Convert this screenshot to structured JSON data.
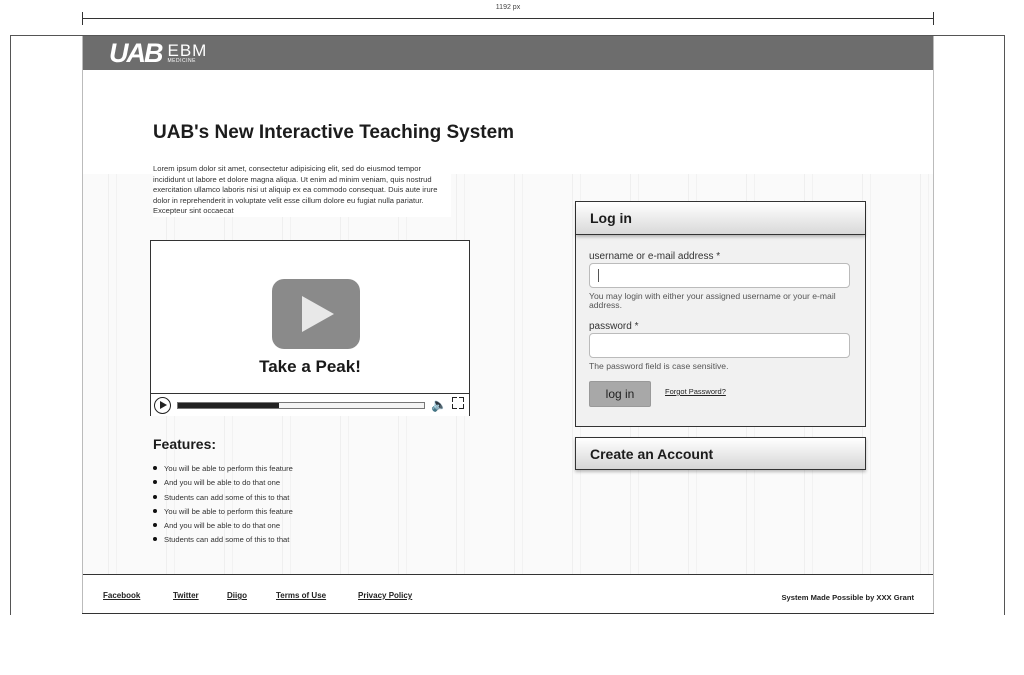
{
  "ruler": {
    "label": "1192 px"
  },
  "header": {
    "logo_main": "UAB",
    "logo_sub_top": "EBM",
    "logo_sub_bottom": "MEDICINE"
  },
  "main": {
    "title": "UAB's New Interactive Teaching System",
    "intro": "Lorem ipsum dolor sit amet, consectetur adipisicing elit, sed do eiusmod tempor incididunt ut labore et dolore magna aliqua. Ut enim ad minim veniam, quis nostrud exercitation ullamco laboris nisi ut aliquip ex ea commodo consequat. Duis aute irure dolor in reprehenderit in voluptate velit esse cillum dolore eu fugiat nulla pariatur. Excepteur sint occaecat",
    "video": {
      "caption": "Take a Peak!",
      "progress_fraction": 0.41
    },
    "features_title": "Features:",
    "features": [
      "You will be able to perform this feature",
      "And you will be able to do that one",
      "Students can add some of this to that",
      "You will be able to perform this feature",
      "And you will be able to do that one",
      "Students can add some of this to that"
    ]
  },
  "login": {
    "title": "Log in",
    "username_label": "username or e-mail address *",
    "username_value": "",
    "username_help": "You may login with either your assigned username or your e-mail address.",
    "password_label": "password *",
    "password_value": "",
    "password_help": "The password field is case sensitive.",
    "submit_label": "log in",
    "forgot_label": "Forgot Password?"
  },
  "create_account": {
    "label": "Create an Account"
  },
  "footer": {
    "links": [
      "Facebook",
      "Twitter",
      "Diigo",
      "Terms of Use",
      "Privacy Policy"
    ],
    "credit": "System Made Possible by XXX Grant"
  }
}
